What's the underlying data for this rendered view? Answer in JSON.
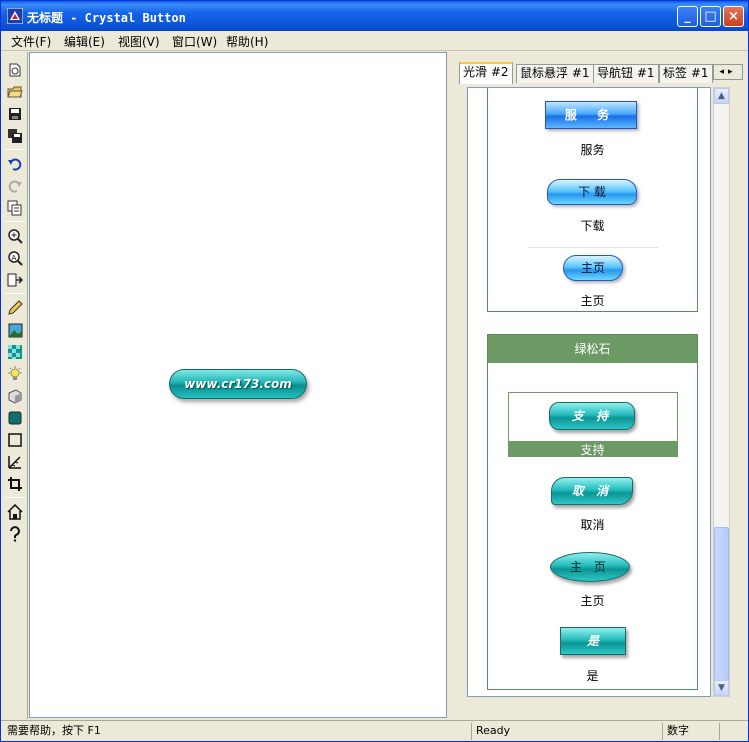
{
  "window": {
    "title": "无标题 - Crystal Button"
  },
  "title_buttons": {
    "minimize": "_",
    "maximize": "□",
    "close": "×"
  },
  "menu": [
    {
      "label": "文件(F)"
    },
    {
      "label": "编辑(E)"
    },
    {
      "label": "视图(V)"
    },
    {
      "label": "窗口(W)"
    },
    {
      "label": "帮助(H)"
    }
  ],
  "toolbar": [
    "new-icon",
    "open-icon",
    "save-icon",
    "save-all-icon",
    "undo-icon",
    "redo-icon",
    "copy-icon",
    "zoom-in-icon",
    "zoom-fit-icon",
    "export-icon",
    "pencil-icon",
    "image-icon",
    "texture-icon",
    "light-icon",
    "shade-icon",
    "fill-icon",
    "rectangle-icon",
    "measure-icon",
    "crop-icon",
    "home-icon",
    "help-icon"
  ],
  "canvas": {
    "button_text": "www.cr173.com"
  },
  "tabs": [
    {
      "label": "光滑 #2",
      "active": true
    },
    {
      "label": "鼠标悬浮 #1",
      "active": false
    },
    {
      "label": "导航钮 #1",
      "active": false
    },
    {
      "label": "标签 #1",
      "active": false
    }
  ],
  "group1": {
    "items": [
      {
        "button": "服 务",
        "label": "服务"
      },
      {
        "button": "下 载",
        "label": "下载"
      },
      {
        "button": "主页",
        "label": "主页"
      }
    ]
  },
  "group2": {
    "title": "绿松石",
    "items": [
      {
        "button": "支 持",
        "label": "支持"
      },
      {
        "button": "取 消",
        "label": "取消"
      },
      {
        "button": "主 页",
        "label": "主页"
      },
      {
        "button": "是",
        "label": "是"
      }
    ]
  },
  "status": {
    "help": "需要帮助，按下 F1",
    "state": "Ready",
    "mode": "数字"
  },
  "colors": {
    "accent": "#0a5fe8",
    "teal": "#1fb3b3",
    "group_green": "#6b9a64"
  }
}
